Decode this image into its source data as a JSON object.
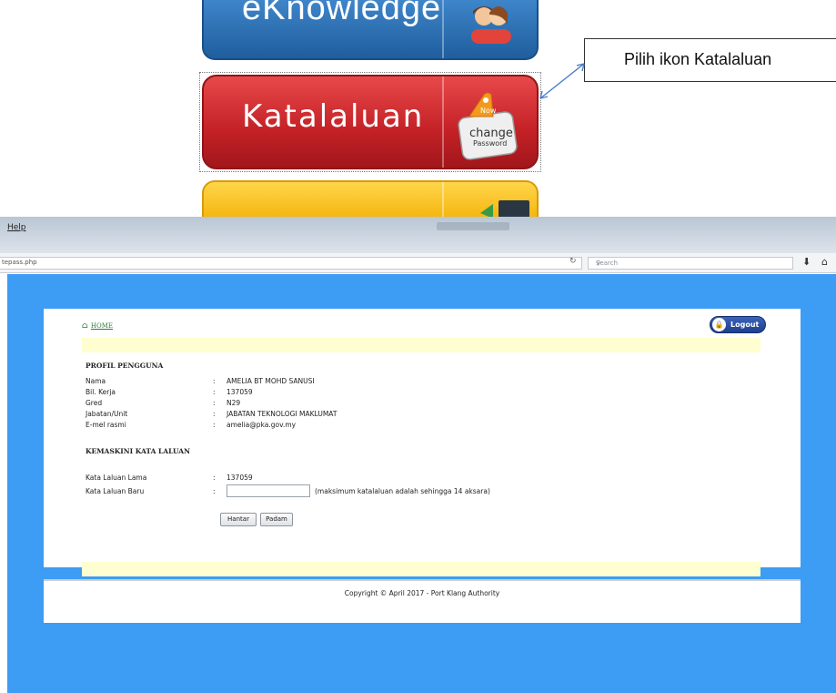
{
  "illustration": {
    "top_tile_text": "eKnowledge",
    "main_tile_text": "Katalaluan",
    "tag_line1": "Now",
    "tag_line2": "change",
    "tag_line3": "Password",
    "callout": "Pilih ikon Katalaluan"
  },
  "browser": {
    "menu_help": "Help",
    "url": "tepass.php",
    "search_placeholder": "Search"
  },
  "page": {
    "home_link": "HOME",
    "logout_label": "Logout",
    "profile_heading": "PROFIL PENGGUNA",
    "profile_rows": [
      {
        "label": "Nama",
        "value": "AMELIA BT MOHD SANUSI"
      },
      {
        "label": "Bil. Kerja",
        "value": "137059"
      },
      {
        "label": "Gred",
        "value": "N29"
      },
      {
        "label": "Jabatan/Unit",
        "value": "JABATAN TEKNOLOGI MAKLUMAT"
      },
      {
        "label": "E-mel rasmi",
        "value": "amelia@pka.gov.my"
      }
    ],
    "update_heading": "KEMASKINI KATA LALUAN",
    "old_pw_label": "Kata Laluan Lama",
    "old_pw_value": "137059",
    "new_pw_label": "Kata Laluan Baru",
    "new_pw_value": "",
    "new_pw_hint": "(maksimum katalaluan adalah sehingga 14 aksara)",
    "colon": ":",
    "submit_label": "Hantar",
    "reset_label": "Padam",
    "footer": "Copyright © April 2017 - Port Klang Authority"
  },
  "colors": {
    "viewport_bg": "#3d9cf4",
    "band_bg": "#fefed0",
    "katalaluan_red": "#c32126",
    "logout_blue": "#1d3f8e"
  }
}
